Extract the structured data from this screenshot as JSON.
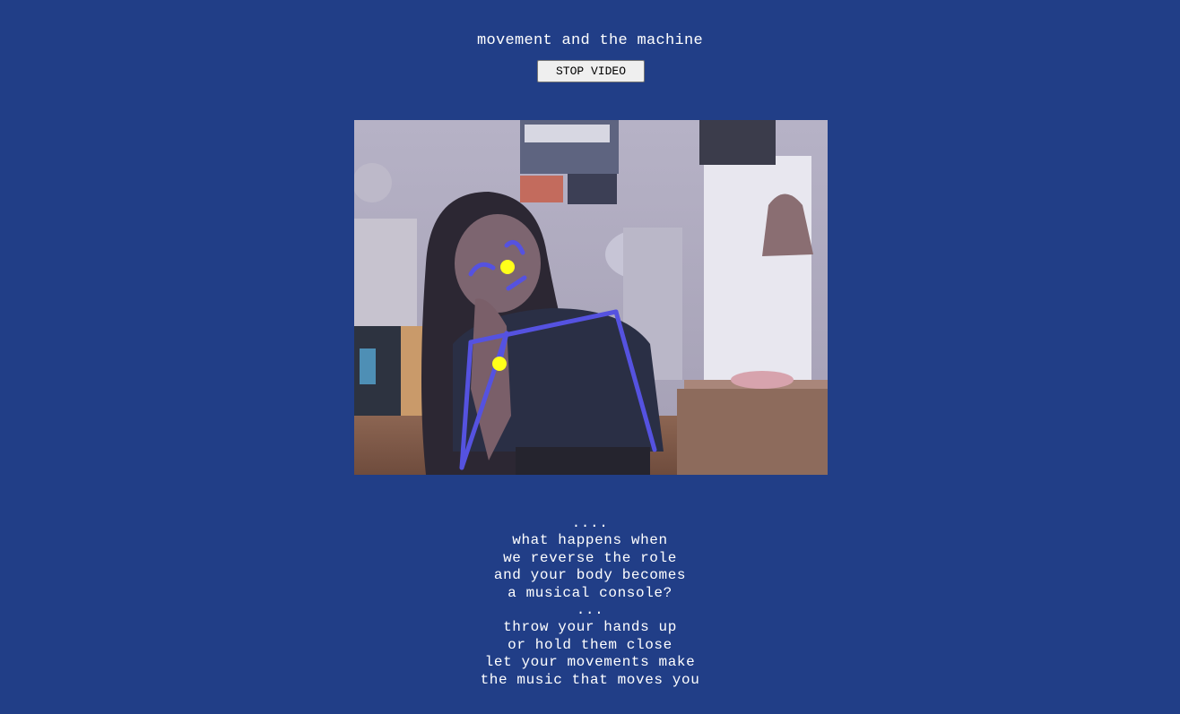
{
  "header": {
    "title": "movement and the machine",
    "stop_button_label": "STOP VIDEO"
  },
  "colors": {
    "background": "#213e87",
    "skeleton": "#5552e0",
    "keypoint": "#ffff1a"
  },
  "video": {
    "skeleton_color": "#5552e0",
    "keypoint_color": "#ffff1a"
  },
  "poem": {
    "lines": [
      "....",
      "what happens when",
      "we reverse the role",
      "and your body becomes",
      "a musical console?",
      "...",
      "throw your hands up",
      "or hold them close",
      "let your movements make",
      "the music that moves you"
    ]
  }
}
